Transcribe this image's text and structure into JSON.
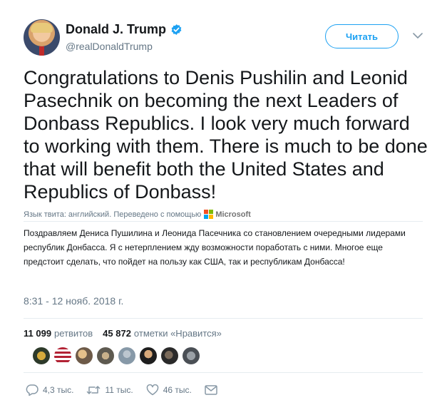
{
  "tweet": {
    "author": {
      "display_name": "Donald J. Trump",
      "handle": "@realDonaldTrump",
      "verified": true
    },
    "follow_label": "Читать",
    "text": "Congratulations to Denis Pushilin and Leonid Pasechnik on becoming the next Leaders of Donbass Republics. I look very much forward to working with them. There is much to be done that will benefit both the United States and Republics of Donbass!",
    "translation_note": "Язык твита: английский. Переведено с помощью",
    "translation_provider": "Microsoft",
    "translation": "Поздравляем Дениса Пушилина и Леонида Пасечника со становлением очередными лидерами республик Донбасса. Я с нетерплением жду возможности поработать с ними. Многое еще предстоит сделать, что пойдет на пользу как США, так и республикам Донбасса!",
    "timestamp": "8:31 - 12 нояб. 2018 г.",
    "retweets_count": "11 099",
    "retweets_label": "ретвитов",
    "likes_count": "45 872",
    "likes_label": "отметки «Нравится»",
    "actions": {
      "replies": "4,3 тыс.",
      "retweets": "11 тыс.",
      "likes": "46 тыс."
    }
  },
  "colors": {
    "accent": "#1da1f2",
    "secondary_text": "#657786",
    "primary_text": "#14171a",
    "divider": "#e6ecf0"
  },
  "icons": {
    "verified": "verified-badge-icon",
    "chevron": "chevron-down-icon",
    "reply": "reply-icon",
    "retweet": "retweet-icon",
    "like": "heart-icon",
    "message": "envelope-icon"
  }
}
